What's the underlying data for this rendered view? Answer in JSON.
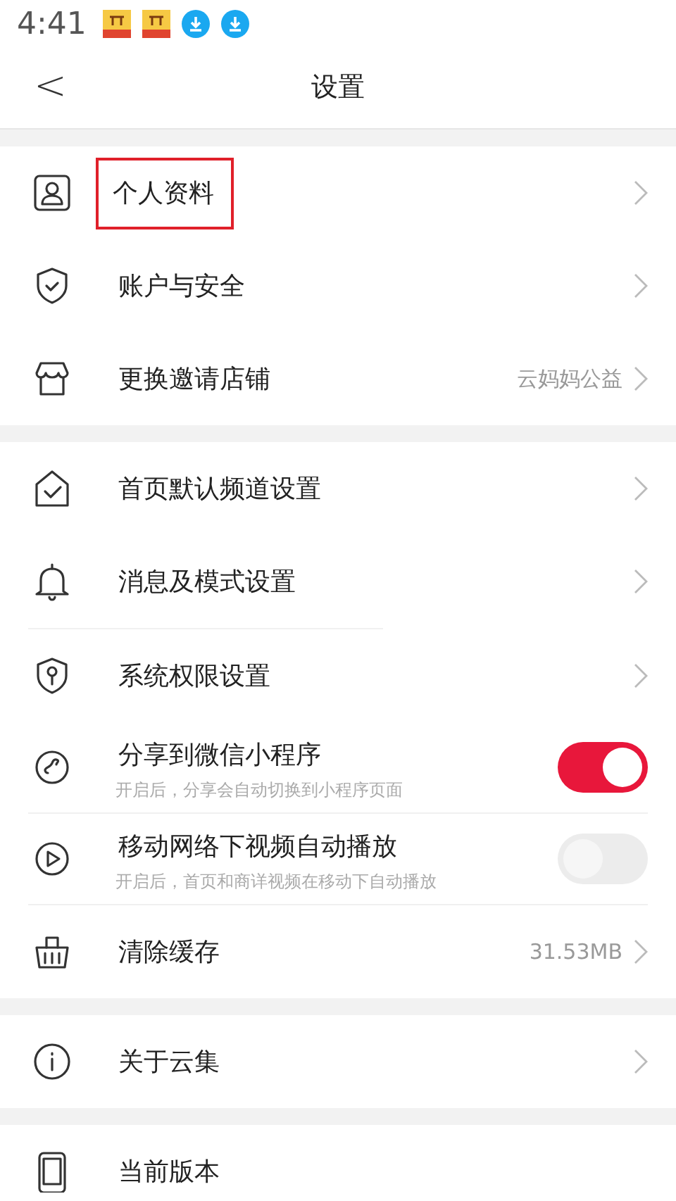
{
  "status_bar": {
    "time": "4:41"
  },
  "header": {
    "back": "<",
    "title": "设置"
  },
  "groups": [
    {
      "rows": [
        {
          "kind": "link",
          "label": "个人资料",
          "highlighted": true
        },
        {
          "kind": "link",
          "label": "账户与安全",
          "highlighted": false
        },
        {
          "kind": "link",
          "label": "更换邀请店铺",
          "value": "云妈妈公益",
          "highlighted": false
        }
      ]
    },
    {
      "rows": [
        {
          "kind": "link",
          "label": "首页默认频道设置",
          "highlighted": false
        },
        {
          "kind": "link",
          "label": "消息及模式设置",
          "highlighted": false,
          "separator_after": true
        },
        {
          "kind": "link",
          "label": "系统权限设置",
          "highlighted": false
        },
        {
          "kind": "toggle",
          "label": "分享到微信小程序",
          "hint": "开启后，分享会自动切换到小程序页面",
          "on": true,
          "separator_after": true
        },
        {
          "kind": "toggle",
          "label": "移动网络下视频自动播放",
          "hint": "开启后，首页和商详视频在移动下自动播放",
          "on": false,
          "separator_after": true
        },
        {
          "kind": "link",
          "label": "清除缓存",
          "value": "31.53MB",
          "highlighted": false
        }
      ]
    },
    {
      "rows": [
        {
          "kind": "link",
          "label": "关于云集",
          "highlighted": false
        }
      ]
    },
    {
      "rows": [
        {
          "kind": "plain",
          "label": "当前版本"
        }
      ]
    }
  ]
}
